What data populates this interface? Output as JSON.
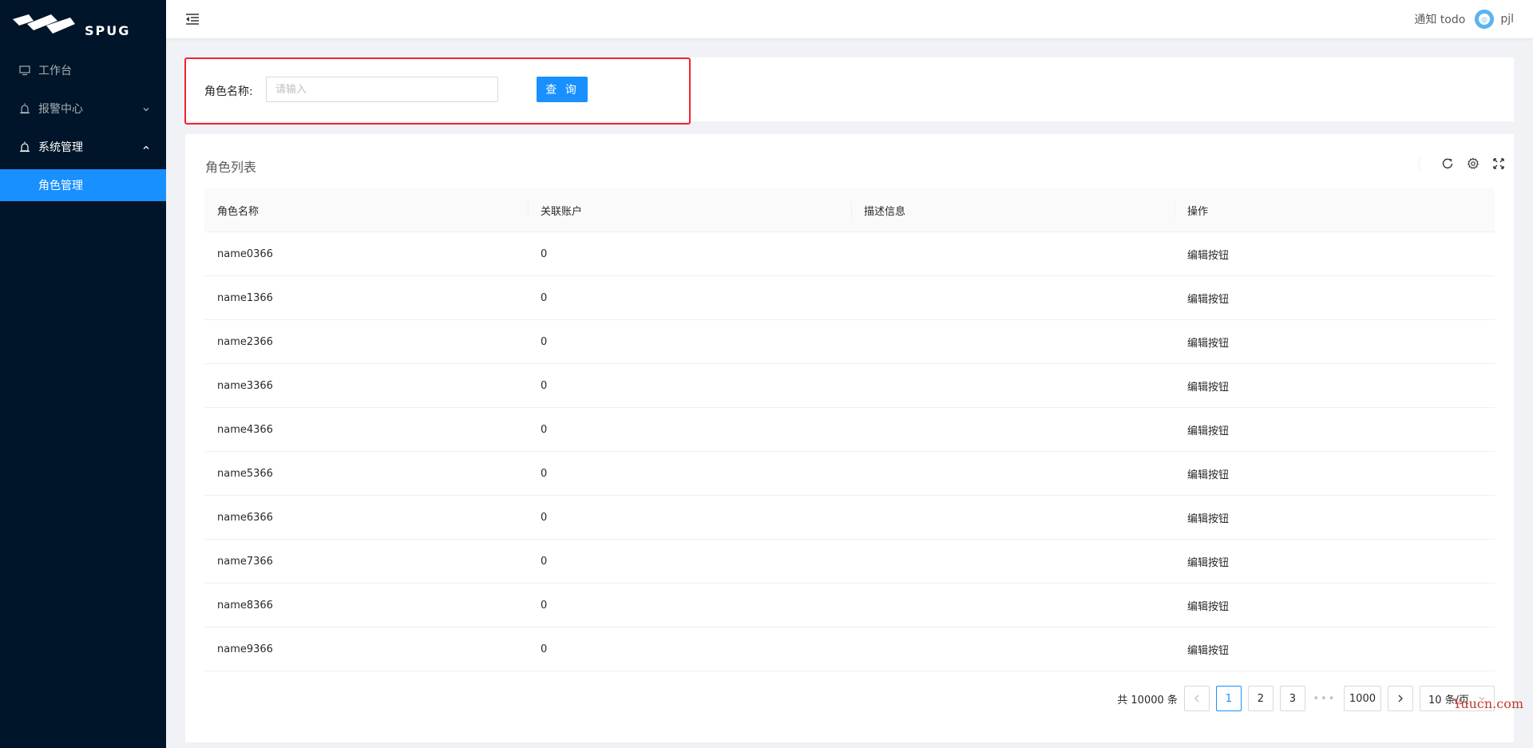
{
  "app": {
    "logo_text": "SPUG"
  },
  "sidebar": {
    "items": [
      {
        "label": "工作台",
        "icon": "desktop-icon"
      },
      {
        "label": "报警中心",
        "icon": "alarm-icon"
      },
      {
        "label": "系统管理",
        "icon": "alarm-icon",
        "children": [
          {
            "label": "角色管理"
          }
        ]
      }
    ]
  },
  "header": {
    "notify": "通知 todo",
    "username": "pjl"
  },
  "search": {
    "label": "角色名称:",
    "placeholder": "请输入",
    "value": "",
    "button": "查 询"
  },
  "table_card": {
    "title": "角色列表",
    "columns": [
      "角色名称",
      "关联账户",
      "描述信息",
      "操作"
    ],
    "rows": [
      {
        "name": "name0366",
        "accounts": "0",
        "desc": "",
        "action": "编辑按钮"
      },
      {
        "name": "name1366",
        "accounts": "0",
        "desc": "",
        "action": "编辑按钮"
      },
      {
        "name": "name2366",
        "accounts": "0",
        "desc": "",
        "action": "编辑按钮"
      },
      {
        "name": "name3366",
        "accounts": "0",
        "desc": "",
        "action": "编辑按钮"
      },
      {
        "name": "name4366",
        "accounts": "0",
        "desc": "",
        "action": "编辑按钮"
      },
      {
        "name": "name5366",
        "accounts": "0",
        "desc": "",
        "action": "编辑按钮"
      },
      {
        "name": "name6366",
        "accounts": "0",
        "desc": "",
        "action": "编辑按钮"
      },
      {
        "name": "name7366",
        "accounts": "0",
        "desc": "",
        "action": "编辑按钮"
      },
      {
        "name": "name8366",
        "accounts": "0",
        "desc": "",
        "action": "编辑按钮"
      },
      {
        "name": "name9366",
        "accounts": "0",
        "desc": "",
        "action": "编辑按钮"
      }
    ]
  },
  "pagination": {
    "total": "共 10000 条",
    "pages": [
      "1",
      "2",
      "3"
    ],
    "current": "1",
    "ellipsis": "•••",
    "last": "1000",
    "page_size": "10 条/页"
  },
  "watermark": "Yuucn.com",
  "colors": {
    "sidebar_bg": "#001529",
    "primary": "#1890ff",
    "highlight_border": "#f5222d"
  }
}
